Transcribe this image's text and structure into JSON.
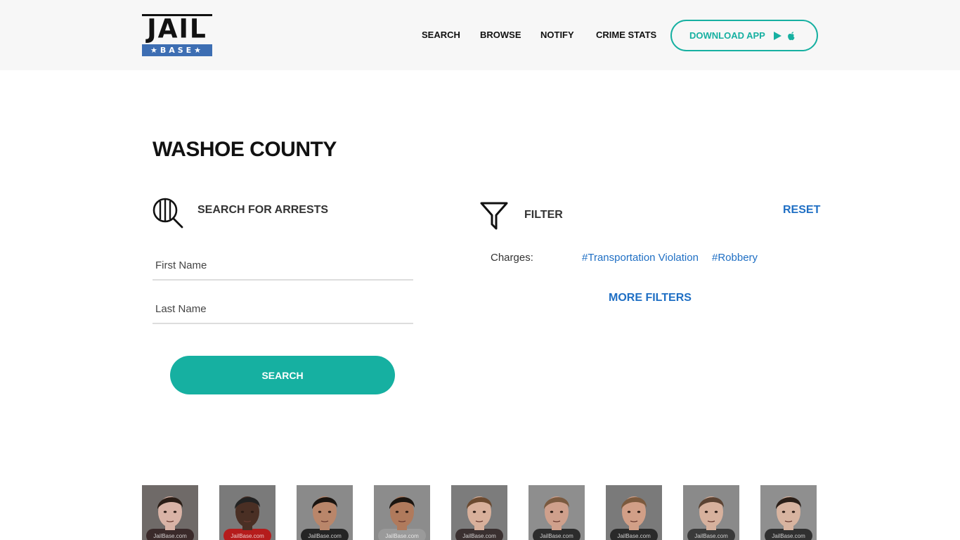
{
  "header": {
    "logo": {
      "top": "JAIL",
      "bottom": "BASE",
      "colors": {
        "dark": "#111111",
        "band": "#3d6eb3"
      }
    },
    "nav": [
      "SEARCH",
      "BROWSE",
      "NOTIFY",
      "CRIME STATS"
    ],
    "download": {
      "label": "DOWNLOAD APP",
      "icons": [
        "google-play-icon",
        "apple-icon"
      ],
      "color": "#16b0a1"
    }
  },
  "page": {
    "title": "WASHOE COUNTY"
  },
  "search": {
    "heading": "SEARCH FOR ARRESTS",
    "icon": "search-bars-icon",
    "first_name_placeholder": "First Name",
    "last_name_placeholder": "Last Name",
    "button": "SEARCH",
    "accent": "#16b0a1"
  },
  "filter": {
    "heading": "FILTER",
    "icon": "funnel-icon",
    "reset": "RESET",
    "charges_label": "Charges:",
    "charges": [
      "#Transportation Violation",
      "#Robbery"
    ],
    "more": "MORE FILTERS",
    "link_color": "#1f6fc4"
  },
  "mugshots": [
    {
      "bg": "#6f6a68",
      "skin": "#d9b3a6",
      "hair": "#2a1d16",
      "shirt": "#3a2a2a",
      "watermark": "JailBase.com"
    },
    {
      "bg": "#7a7a7a",
      "skin": "#4a2f24",
      "hair": "#222222",
      "shirt": "#b51c1c",
      "watermark": "JailBase.com"
    },
    {
      "bg": "#8a8a8a",
      "skin": "#b9866a",
      "hair": "#1a1410",
      "shirt": "#242424",
      "watermark": "JailBase.com"
    },
    {
      "bg": "#8c8c8c",
      "skin": "#b07a5c",
      "hair": "#1b1510",
      "shirt": "#9a9a9a",
      "watermark": "JailBase.com"
    },
    {
      "bg": "#7c7c7c",
      "skin": "#d8b09b",
      "hair": "#6b4a30",
      "shirt": "#3a3030",
      "watermark": "JailBase.com"
    },
    {
      "bg": "#8e8e8e",
      "skin": "#cfa08c",
      "hair": "#7a5a40",
      "shirt": "#2c2c2c",
      "watermark": "JailBase.com"
    },
    {
      "bg": "#7a7a7a",
      "skin": "#d19f87",
      "hair": "#7b5a3e",
      "shirt": "#2a2a2a",
      "watermark": "JailBase.com"
    },
    {
      "bg": "#8a8a8a",
      "skin": "#d7b19d",
      "hair": "#5b4333",
      "shirt": "#3a3a3a",
      "watermark": "JailBase.com"
    },
    {
      "bg": "#8f8f8f",
      "skin": "#d8b4a0",
      "hair": "#2b1f18",
      "shirt": "#303030",
      "watermark": "JailBase.com"
    }
  ]
}
